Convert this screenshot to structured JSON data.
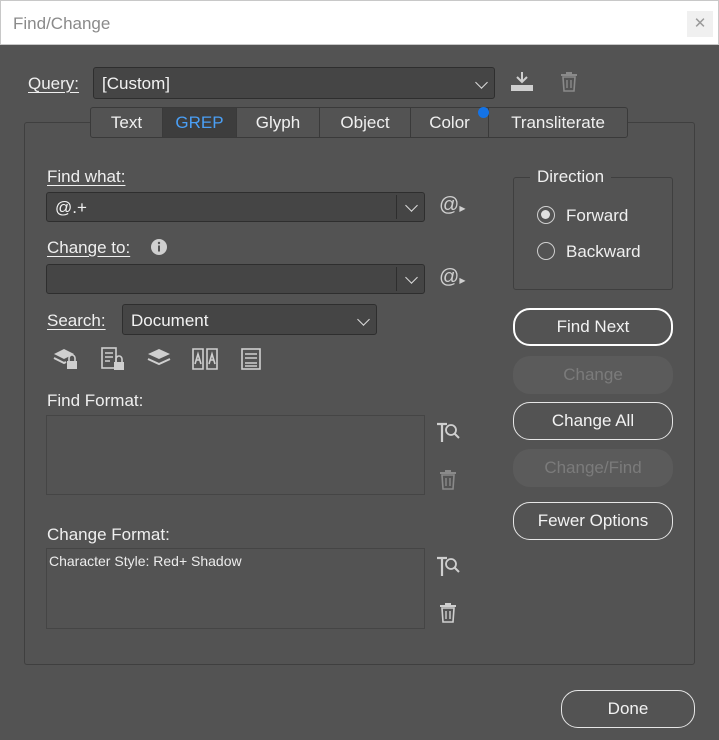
{
  "window": {
    "title": "Find/Change",
    "close": "✕"
  },
  "query": {
    "label": "Query:",
    "value": "[Custom]"
  },
  "tabs": [
    {
      "label": "Text"
    },
    {
      "label": "GREP"
    },
    {
      "label": "Glyph"
    },
    {
      "label": "Object"
    },
    {
      "label": "Color"
    },
    {
      "label": "Transliterate"
    }
  ],
  "find_what": {
    "label": "Find what:",
    "value": "@.+"
  },
  "change_to": {
    "label": "Change to:",
    "value": ""
  },
  "special_char": {
    "glyph": "@"
  },
  "search": {
    "label": "Search:",
    "value": "Document"
  },
  "find_format": {
    "label": "Find Format:",
    "value": ""
  },
  "change_format": {
    "label": "Change Format:",
    "value": "Character Style: Red+ Shadow"
  },
  "direction": {
    "label": "Direction",
    "options": [
      {
        "label": "Forward",
        "selected": true
      },
      {
        "label": "Backward",
        "selected": false
      }
    ]
  },
  "buttons": {
    "find_next": "Find Next",
    "change": "Change",
    "change_all": "Change All",
    "change_find": "Change/Find",
    "fewer_options": "Fewer Options",
    "done": "Done"
  },
  "colors": {
    "background": "#535353",
    "accent": "#4a9ff5",
    "blue_dot": "#1473e6"
  }
}
